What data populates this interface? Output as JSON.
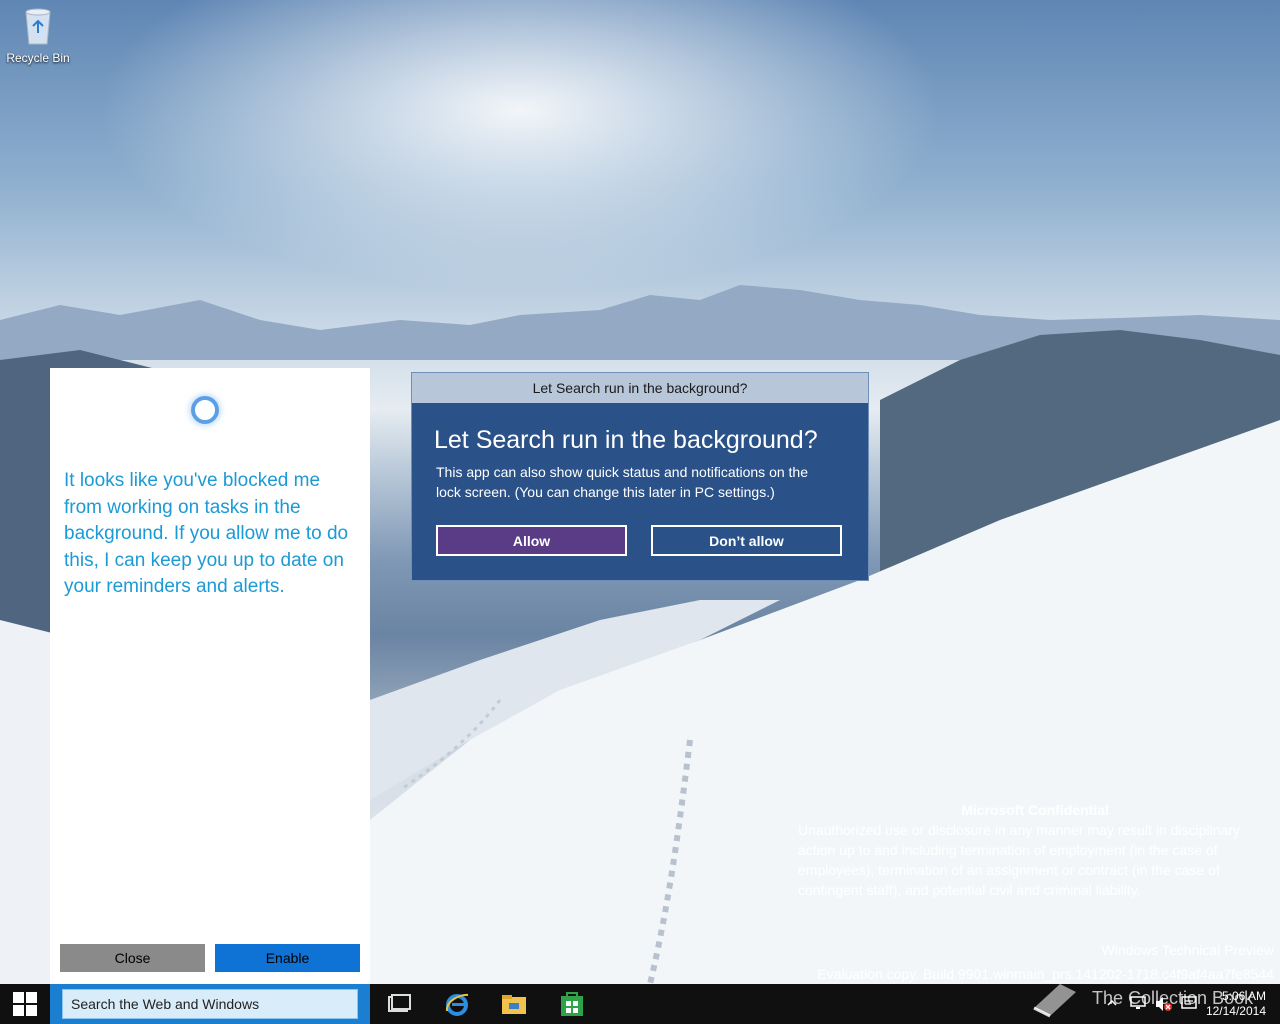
{
  "desktop": {
    "recycle_bin_label": "Recycle Bin"
  },
  "cortana": {
    "message": "It looks like you've blocked me from working on tasks in the background. If you allow me to do this, I can keep you up to date on your reminders and alerts.",
    "close_label": "Close",
    "enable_label": "Enable"
  },
  "dialog": {
    "window_title": "Let Search run in the background?",
    "heading": "Let Search run in the background?",
    "description": "This app can also show quick status and notifications on the lock screen. (You can change this later in PC settings.)",
    "allow_label": "Allow",
    "deny_label": "Don’t allow"
  },
  "watermark": {
    "confidential_title": "Microsoft Confidential",
    "confidential_text": "Unauthorized use or disclosure in any manner may result in disciplinary action up to and including termination of employment (in the case of employees), termination of an assignment or contract (in the case of contingent staff), and potential civil and criminal liability.",
    "edition": "Windows Technical Preview",
    "build": "Evaluation copy. Build 9901.winmain_prs.141202-1718.c4f9af4aa7fe8544",
    "overlay_text": "The Collection Book"
  },
  "taskbar": {
    "search_placeholder": "Search the Web and Windows",
    "time": "5:06 AM",
    "date": "12/14/2014"
  },
  "colors": {
    "cortana_text": "#1b9ad6",
    "dialog_bg": "#2a5289",
    "allow_bg": "#5a3b86",
    "enable_bg": "#0f73d6",
    "search_area": "#1b7fd1"
  }
}
